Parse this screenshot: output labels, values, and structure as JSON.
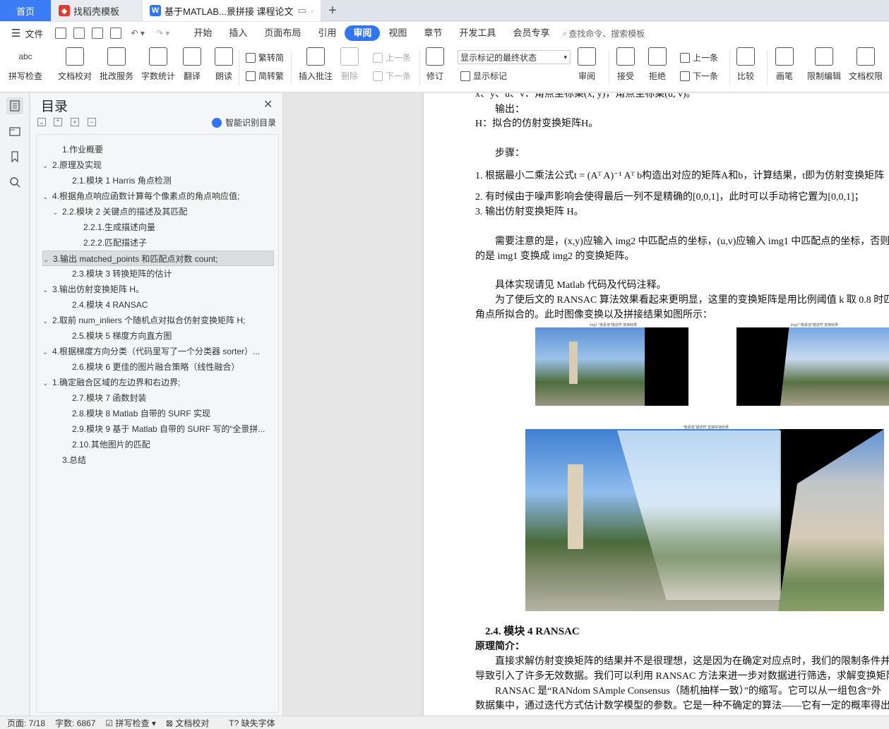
{
  "tabs": [
    {
      "label": "首页"
    },
    {
      "label": "找稻壳模板"
    },
    {
      "label": "基于MATLAB...景拼接 课程论文"
    }
  ],
  "menu": {
    "file": "文件",
    "items": [
      "开始",
      "插入",
      "页面布局",
      "引用",
      "审阅",
      "视图",
      "章节",
      "开发工具",
      "会员专享"
    ],
    "active": "审阅",
    "search": "查找命令、搜索模板"
  },
  "ribbon": {
    "spell": "拼写检查",
    "proof": "文档校对",
    "batch": "批改服务",
    "count": "字数统计",
    "translate": "翻译",
    "read": "朗读",
    "trad": "繁转简",
    "simp": "简转繁",
    "insert_comment": "插入批注",
    "delete": "删除",
    "prev_comment": "上一条",
    "next_comment": "下一条",
    "revise": "修订",
    "markup_select": "显示标记的最终状态",
    "show_markup": "显示标记",
    "review": "审阅",
    "accept": "接受",
    "reject": "拒绝",
    "prev": "上一条",
    "next": "下一条",
    "compare": "比较",
    "pen": "画笔",
    "restrict": "限制编辑",
    "perm": "文档权限",
    "abc": "abc"
  },
  "toc": {
    "title": "目录",
    "smart": "智能识别目录",
    "items": [
      {
        "t": "1.作业概要",
        "lvl": 1,
        "ar": ""
      },
      {
        "t": "2.原理及实现",
        "lvl": 0,
        "ar": "v"
      },
      {
        "t": "2.1.模块 1 Harris 角点检测",
        "lvl": 2,
        "ar": ""
      },
      {
        "t": "4.根据角点响应函数计算每个像素点的角点响应值;",
        "lvl": 0,
        "ar": "v"
      },
      {
        "t": "2.2.模块 2  关键点的描述及其匹配",
        "lvl": 1.5,
        "ar": "v"
      },
      {
        "t": "2.2.1.生成描述向量",
        "lvl": 3,
        "ar": ""
      },
      {
        "t": "2.2.2.匹配描述子",
        "lvl": 3,
        "ar": ""
      },
      {
        "t": "3.输出 matched_points 和匹配点对数 count;",
        "lvl": 0,
        "ar": "v"
      },
      {
        "t": "2.3.模块 3  转换矩阵的估计",
        "lvl": 2,
        "ar": ""
      },
      {
        "t": "3.输出仿射变换矩阵 H。",
        "lvl": 0,
        "ar": "v"
      },
      {
        "t": "2.4.模块 4 RANSAC",
        "lvl": 2,
        "ar": ""
      },
      {
        "t": "2.取前 num_inliers 个随机点对拟合仿射变换矩阵 H;",
        "lvl": 0,
        "ar": "v"
      },
      {
        "t": "2.5.模块 5  梯度方向直方图",
        "lvl": 2,
        "ar": ""
      },
      {
        "t": "4.根据梯度方向分类（代码里写了一个分类器 sorter）...",
        "lvl": 0,
        "ar": "v"
      },
      {
        "t": "2.6.模块 6  更佳的图片融合策略（线性融合）",
        "lvl": 2,
        "ar": ""
      },
      {
        "t": "1.确定融合区域的左边界和右边界;",
        "lvl": 0,
        "ar": "v"
      },
      {
        "t": "2.7.模块 7  函数封装",
        "lvl": 2,
        "ar": ""
      },
      {
        "t": "2.8.模块 8 Matlab 自带的 SURF 实现",
        "lvl": 2,
        "ar": ""
      },
      {
        "t": "2.9.模块 9  基于 Matlab 自带的 SURF 写的“全景拼...",
        "lvl": 2,
        "ar": ""
      },
      {
        "t": "2.10.其他图片的匹配",
        "lvl": 2,
        "ar": ""
      },
      {
        "t": "3.总结",
        "lvl": 1,
        "ar": ""
      }
    ],
    "selected": 7
  },
  "doc": {
    "l0": "x、y、u、v：角点坐标集(x, y)，角点坐标集(u, v)。",
    "l1": "输出：",
    "l2": "H：拟合的仿射变换矩阵H。",
    "l3": "步骤：",
    "l4": "1.   根据最小二乘法公式t = (Aᵀ A)⁻¹ Aᵀ b构造出对应的矩阵A和b，计算结果，t即为仿射变换矩阵",
    "l5": "2.   有时候由于噪声影响会使得最后一列不是精确的[0,0,1]，此时可以手动将它置为[0,0,1]；",
    "l6": "3.   输出仿射变换矩阵 H。",
    "l7": "需要注意的是，(x,y)应输入 img2 中匹配点的坐标，(u,v)应输入 img1 中匹配点的坐标，否则",
    "l8": "的是 img1 变换成 img2 的变换矩阵。",
    "l9": "具体实现请见 Matlab 代码及代码注释。",
    "l10": "为了使后文的 RANSAC 算法效果看起来更明显，这里的变换矩阵是用比例阈值 k 取 0.8 时匹",
    "l11": "角点所拟合的。此时图像变换以及拼接结果如图所示：",
    "fig1": "img1 \"像素值\"描述符 变换结果",
    "fig2": "img2 \"像素值\"描述符 变换结果",
    "fig3": "\"像素值\"描述符 直接拼接结果",
    "h": "2.4.   模块 4 RANSAC",
    "l12": "原理简介：",
    "l13": "直接求解仿射变换矩阵的结果并不是很理想，这是因为在确定对应点时，我们的限制条件并",
    "l14": "导致引入了许多无效数据。我们可以利用 RANSAC 方法来进一步对数据进行筛选，求解变换矩阵",
    "l15": "RANSAC 是“RANdom SAmple Consensus（随机抽样一致）”的缩写。它可以从一组包含“外",
    "l16": "数据集中，通过迭代方式估计数学模型的参数。它是一种不确定的算法——它有一定的概率得出"
  },
  "status": {
    "page": "页面: 7/18",
    "words": "字数: 6867",
    "spell": "拼写检查",
    "proof": "文档校对",
    "font": "缺失字体"
  }
}
